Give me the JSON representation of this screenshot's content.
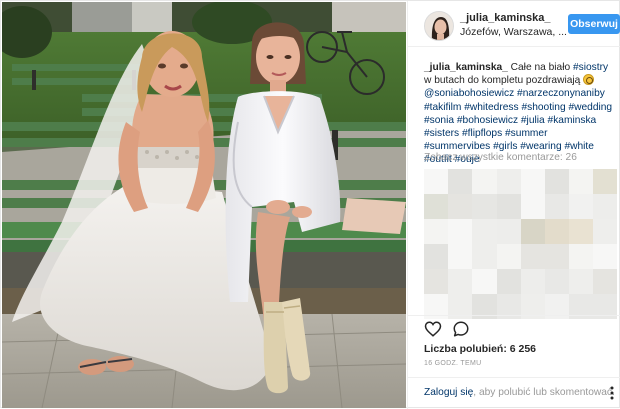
{
  "post": {
    "header": {
      "username": "_julia_kaminska_",
      "location": "Józefów, Warszawa, ...",
      "follow_label": "Obserwuj"
    },
    "caption": {
      "author": "_julia_kaminska_",
      "text_1": " Całe na biało ",
      "tag_siostry": "#siostry",
      "text_2": " w butach do kompletu pozdrawiają ",
      "mention": "@soniabohosiewicz",
      "tags": [
        "#narzeczonynaniby",
        "#takifilm",
        "#whitedress",
        "#shooting",
        "#wedding",
        "#sonia",
        "#bohosiewicz",
        "#julia",
        "#kaminska",
        "#sisters",
        "#flipflops",
        "#summer",
        "#summervibes",
        "#girls",
        "#wearing",
        "#white",
        "#outfit",
        "#ouje"
      ]
    },
    "view_comments_label": "Zobacz wszystkie komentarze: 26",
    "likes_label": "Liczba polubień: 6 256",
    "timestamp": "16 GODZ. TEMU",
    "login": {
      "link_label": "Zaloguj się",
      "rest_label": ", aby polubić lub skomentować."
    },
    "icons": {
      "like": "heart-icon",
      "comment": "comment-icon",
      "more": "more-options-icon"
    },
    "colors": {
      "follow_button": "#3897f0",
      "link": "#003569",
      "muted": "#999999"
    }
  }
}
